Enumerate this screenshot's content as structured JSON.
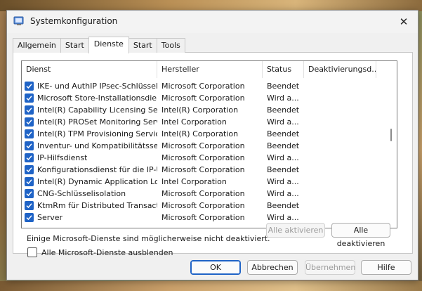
{
  "window": {
    "title": "Systemkonfiguration"
  },
  "tabs": [
    {
      "label": "Allgemein"
    },
    {
      "label": "Start"
    },
    {
      "label": "Dienste"
    },
    {
      "label": "Start"
    },
    {
      "label": "Tools"
    }
  ],
  "active_tab": "Dienste",
  "list": {
    "columns": [
      "Dienst",
      "Hersteller",
      "Status",
      "Deaktivierungsd..."
    ],
    "rows": [
      {
        "name": "IKE- und AuthIP IPsec-Schlüssel...",
        "vendor": "Microsoft Corporation",
        "status": "Beendet",
        "checked": true
      },
      {
        "name": "Microsoft Store-Installationsdienst",
        "vendor": "Microsoft Corporation",
        "status": "Wird a...",
        "checked": true
      },
      {
        "name": "Intel(R) Capability Licensing Ser...",
        "vendor": "Intel(R) Corporation",
        "status": "Beendet",
        "checked": true
      },
      {
        "name": "Intel(R) PROSet Monitoring Service",
        "vendor": "Intel Corporation",
        "status": "Wird a...",
        "checked": true
      },
      {
        "name": "Intel(R) TPM Provisioning Service",
        "vendor": "Intel(R) Corporation",
        "status": "Beendet",
        "checked": true
      },
      {
        "name": "Inventur- und Kompatibilitätssen...",
        "vendor": "Microsoft Corporation",
        "status": "Beendet",
        "checked": true
      },
      {
        "name": "IP-Hilfsdienst",
        "vendor": "Microsoft Corporation",
        "status": "Wird a...",
        "checked": true
      },
      {
        "name": "Konfigurationsdienst für die IP-Ü...",
        "vendor": "Microsoft Corporation",
        "status": "Beendet",
        "checked": true
      },
      {
        "name": "Intel(R) Dynamic Application Loa...",
        "vendor": "Intel Corporation",
        "status": "Wird a...",
        "checked": true
      },
      {
        "name": "CNG-Schlüsselisolation",
        "vendor": "Microsoft Corporation",
        "status": "Wird a...",
        "checked": true
      },
      {
        "name": "KtmRm für Distributed Transacti...",
        "vendor": "Microsoft Corporation",
        "status": "Beendet",
        "checked": true
      },
      {
        "name": "Server",
        "vendor": "Microsoft Corporation",
        "status": "Wird a...",
        "checked": true
      }
    ]
  },
  "note": "Einige Microsoft-Dienste sind möglicherweise nicht deaktiviert.",
  "buttons": {
    "enable_all": "Alle aktivieren",
    "disable_all": "Alle deaktivieren",
    "ok": "OK",
    "cancel": "Abbrechen",
    "apply": "Übernehmen",
    "help": "Hilfe"
  },
  "hide_ms_label": "Alle Microsoft-Dienste ausblenden",
  "hide_ms_checked": false,
  "colors": {
    "checkbox_blue": "#1f63c6",
    "window_bg": "#f0f0f0"
  }
}
